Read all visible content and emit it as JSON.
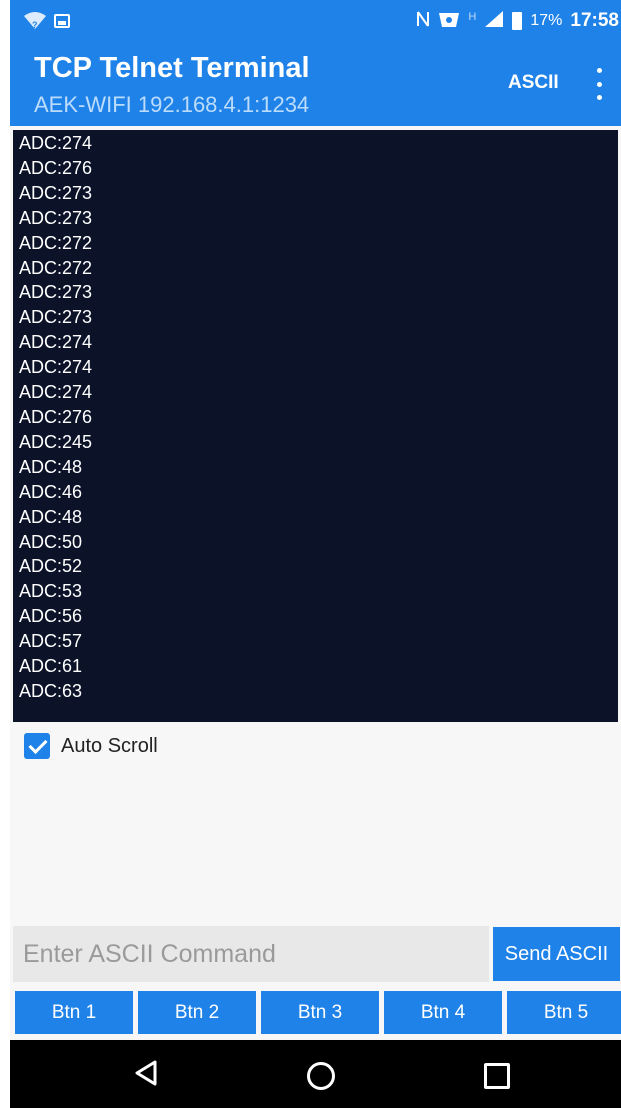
{
  "status_bar": {
    "battery_percent": "17%",
    "time": "17:58",
    "network_letter": "H",
    "icons": [
      "wifi-question-icon",
      "image-notification-icon",
      "nfc-icon",
      "vpn-key-icon",
      "signal-icon",
      "battery-icon"
    ]
  },
  "app_bar": {
    "title": "TCP Telnet Terminal",
    "subtitle": "AEK-WIFI 192.168.4.1:1234",
    "mode_label": "ASCII",
    "menu_icon": "more-vert-icon"
  },
  "terminal": {
    "lines": [
      "ADC:274",
      "ADC:276",
      "ADC:273",
      "ADC:273",
      "ADC:272",
      "ADC:272",
      "ADC:273",
      "ADC:273",
      "ADC:274",
      "ADC:274",
      "ADC:274",
      "ADC:276",
      "ADC:245",
      "ADC:48",
      "ADC:46",
      "ADC:48",
      "ADC:50",
      "ADC:52",
      "ADC:53",
      "ADC:56",
      "ADC:57",
      "ADC:61",
      "ADC:63"
    ]
  },
  "auto_scroll": {
    "label": "Auto Scroll",
    "checked": true
  },
  "command": {
    "placeholder": "Enter ASCII Command",
    "value": "",
    "send_label": "Send ASCII"
  },
  "buttons": [
    {
      "label": "Btn 1"
    },
    {
      "label": "Btn 2"
    },
    {
      "label": "Btn 3"
    },
    {
      "label": "Btn 4"
    },
    {
      "label": "Btn 5"
    }
  ],
  "colors": {
    "primary": "#1f82e8",
    "terminal_bg": "#0c1329",
    "terminal_text": "#ffffff"
  }
}
